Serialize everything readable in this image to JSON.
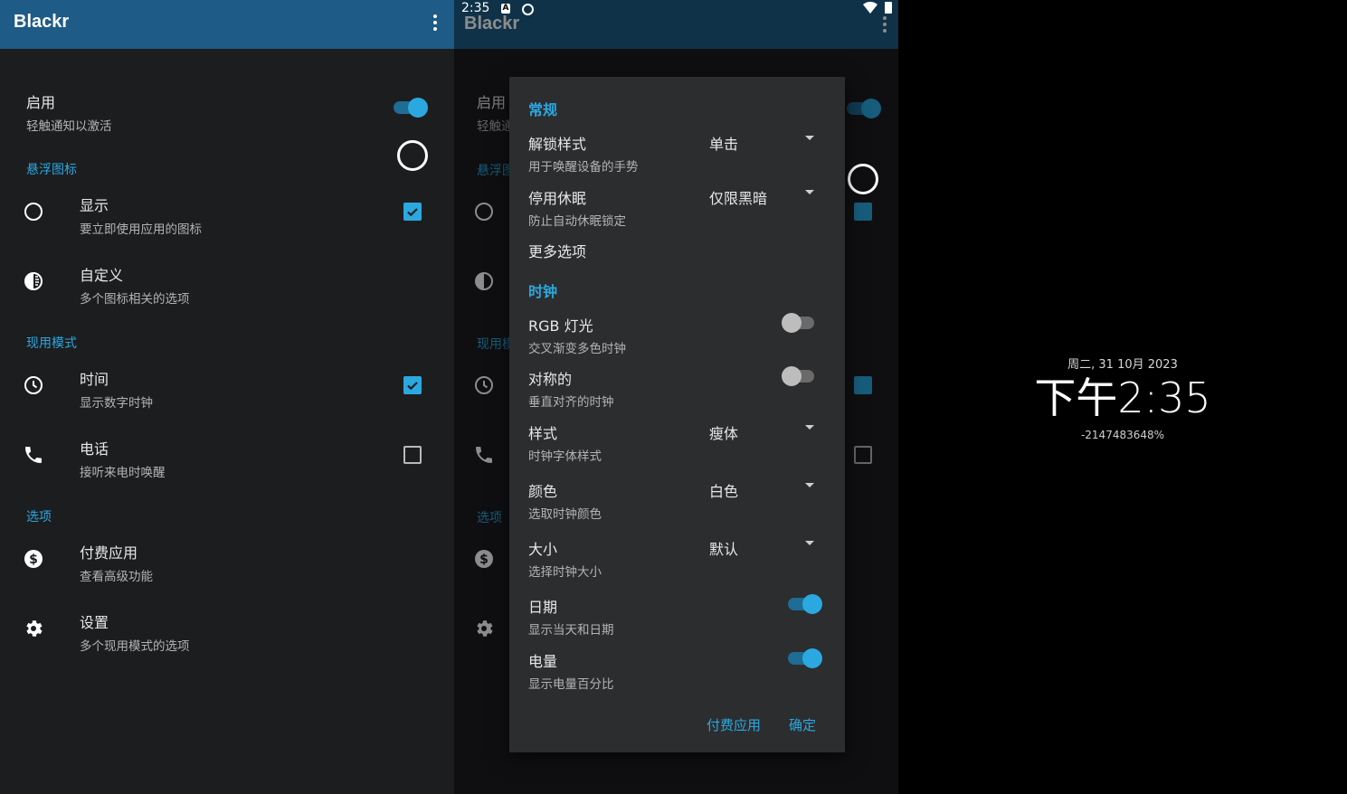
{
  "app_title": "Blackr",
  "status_bar": {
    "time": "2:35",
    "icon_a": "A"
  },
  "main": {
    "enable": {
      "title": "启用",
      "subtitle": "轻触通知以激活"
    },
    "sections": {
      "floating_icon": "悬浮图标",
      "active_mode": "现用模式",
      "options": "选项"
    },
    "items": {
      "show": {
        "title": "显示",
        "subtitle": "要立即使用应用的图标",
        "checked": true
      },
      "custom": {
        "title": "自定义",
        "subtitle": "多个图标相关的选项"
      },
      "time": {
        "title": "时间",
        "subtitle": "显示数字时钟",
        "checked": true
      },
      "phone": {
        "title": "电话",
        "subtitle": "接听来电时唤醒",
        "checked": false
      },
      "paid": {
        "title": "付费应用",
        "subtitle": "查看高级功能"
      },
      "settings": {
        "title": "设置",
        "subtitle": "多个现用模式的选项"
      }
    }
  },
  "dialog": {
    "section_general": "常规",
    "unlock_style": {
      "title": "解锁样式",
      "subtitle": "用于唤醒设备的手势",
      "value": "单击"
    },
    "disable_sleep": {
      "title": "停用休眠",
      "subtitle": "防止自动休眠锁定",
      "value": "仅限黑暗"
    },
    "more_options": "更多选项",
    "section_clock": "时钟",
    "rgb": {
      "title": "RGB 灯光",
      "subtitle": "交叉渐变多色时钟",
      "on": false
    },
    "symmetric": {
      "title": "对称的",
      "subtitle": "垂直对齐的时钟",
      "on": false
    },
    "style": {
      "title": "样式",
      "subtitle": "时钟字体样式",
      "value": "瘦体"
    },
    "color": {
      "title": "颜色",
      "subtitle": "选取时钟颜色",
      "value": "白色"
    },
    "size": {
      "title": "大小",
      "subtitle": "选择时钟大小",
      "value": "默认"
    },
    "date": {
      "title": "日期",
      "subtitle": "显示当天和日期",
      "on": true
    },
    "battery": {
      "title": "电量",
      "subtitle": "显示电量百分比",
      "on": true
    },
    "btn_paid": "付费应用",
    "btn_ok": "确定"
  },
  "clock_screen": {
    "date": "周二, 31 10月 2023",
    "ampm": "下午",
    "time": "2:35",
    "battery": "-2147483648%"
  },
  "colors": {
    "appbar": "#1e5b86",
    "accent": "#2ba8e0",
    "background": "#1c1d1f"
  }
}
